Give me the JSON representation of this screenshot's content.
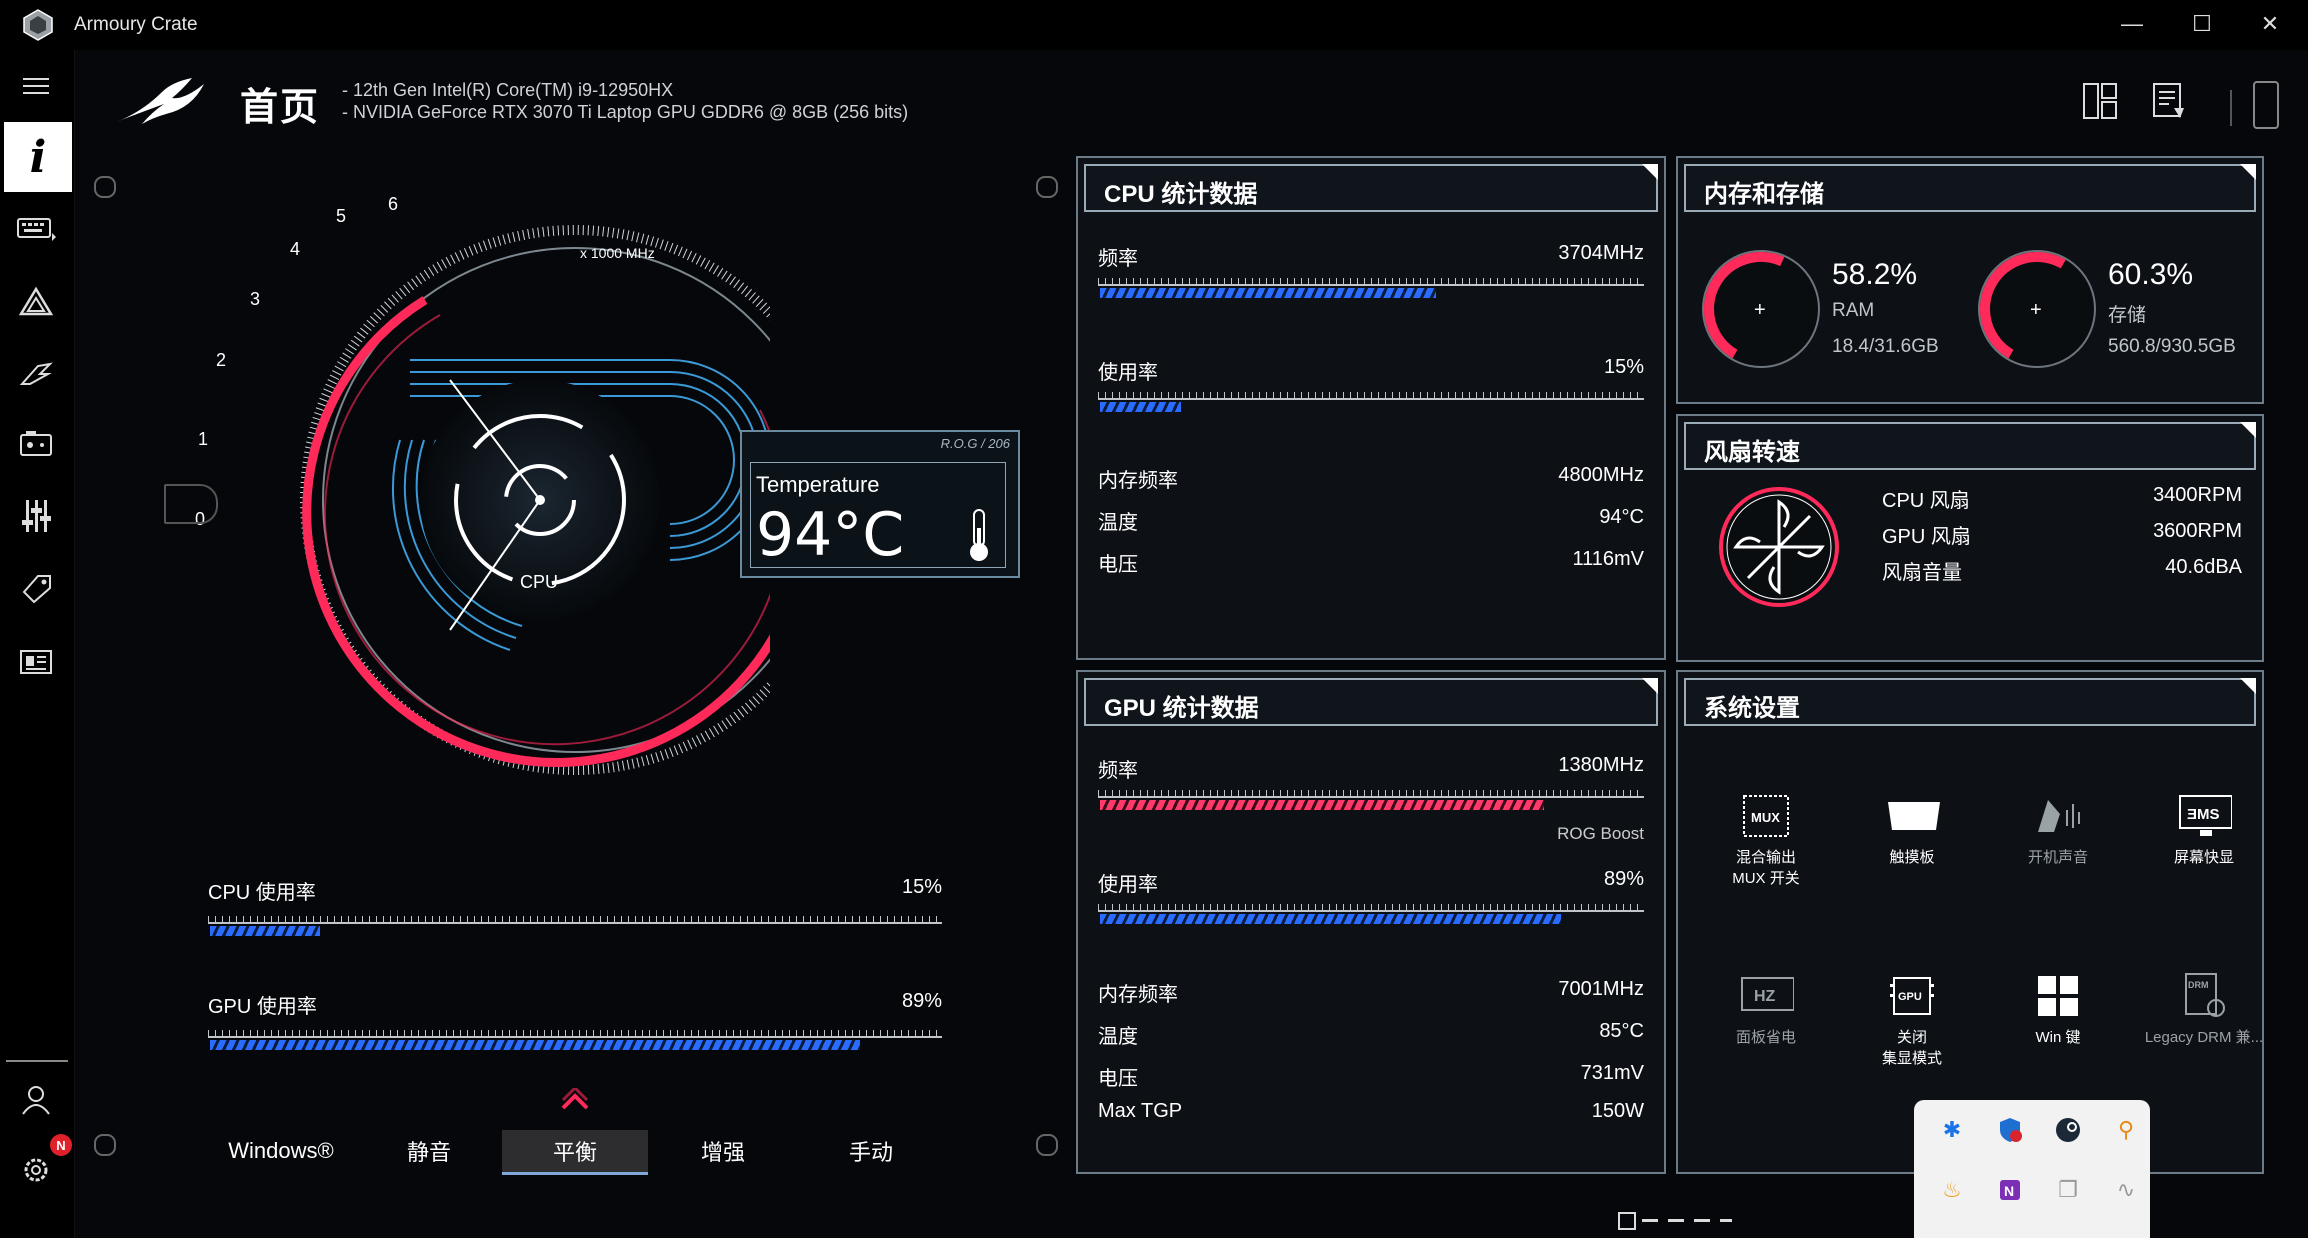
{
  "window": {
    "title": "Armoury Crate",
    "minimize": "—",
    "maximize": "☐",
    "close": "✕"
  },
  "header": {
    "page_title": "首页",
    "cpu_spec": "-   12th Gen Intel(R) Core(TM) i9-12950HX",
    "gpu_spec": "-   NVIDIA GeForce RTX 3070 Ti Laptop GPU GDDR6 @ 8GB (256 bits)"
  },
  "sidebar": {
    "items": [
      "menu-icon",
      "info-icon",
      "keyboard-icon",
      "aura-icon",
      "rog-icon",
      "game-library-icon",
      "scenario-icon",
      "deals-icon",
      "news-icon"
    ],
    "bottom": [
      "user-icon",
      "settings-icon"
    ],
    "settings_badge": "N"
  },
  "gauge": {
    "unit_label": "x 1000 MHz",
    "ticks": [
      "0",
      "1",
      "2",
      "3",
      "4",
      "5",
      "6"
    ],
    "center_label": "CPU",
    "accent": "#ff2a5a"
  },
  "temperature": {
    "tag": "R.O.G / 206",
    "label": "Temperature",
    "value": "94°C"
  },
  "usage": {
    "cpu_label": "CPU 使用率",
    "cpu_value": "15%",
    "cpu_fraction": 0.15,
    "gpu_label": "GPU 使用率",
    "gpu_value": "89%",
    "gpu_fraction": 0.89
  },
  "modes": {
    "items": [
      "Windows®",
      "静音",
      "平衡",
      "增强",
      "手动"
    ],
    "selected": "平衡"
  },
  "cpu_panel": {
    "title": "CPU 统计数据",
    "freq_label": "频率",
    "freq_value": "3704MHz",
    "freq_fraction": 0.62,
    "usage_label": "使用率",
    "usage_value": "15%",
    "usage_fraction": 0.15,
    "mem_freq_label": "内存频率",
    "mem_freq_value": "4800MHz",
    "temp_label": "温度",
    "temp_value": "94°C",
    "volt_label": "电压",
    "volt_value": "1116mV"
  },
  "gpu_panel": {
    "title": "GPU 统计数据",
    "freq_label": "频率",
    "freq_value": "1380MHz",
    "freq_fraction": 0.82,
    "boost_label": "ROG Boost",
    "usage_label": "使用率",
    "usage_value": "89%",
    "usage_fraction": 0.85,
    "mem_freq_label": "内存频率",
    "mem_freq_value": "7001MHz",
    "temp_label": "温度",
    "temp_value": "85°C",
    "volt_label": "电压",
    "volt_value": "731mV",
    "tgp_label": "Max TGP",
    "tgp_value": "150W"
  },
  "memory_panel": {
    "title": "内存和存储",
    "ram_pct": "58.2%",
    "ram_label": "RAM",
    "ram_detail": "18.4/31.6GB",
    "ram_fraction": 0.582,
    "disk_pct": "60.3%",
    "disk_label": "存储",
    "disk_detail": "560.8/930.5GB",
    "disk_fraction": 0.603
  },
  "fan_panel": {
    "title": "风扇转速",
    "cpu_fan_label": "CPU 风扇",
    "cpu_fan_value": "3400RPM",
    "gpu_fan_label": "GPU 风扇",
    "gpu_fan_value": "3600RPM",
    "noise_label": "风扇音量",
    "noise_value": "40.6dBA"
  },
  "system_panel": {
    "title": "系统设置",
    "items": [
      {
        "line1": "混合输出",
        "line2": "MUX 开关"
      },
      {
        "line1": "",
        "line2": "触摸板"
      },
      {
        "line1": "",
        "line2": "开机声音"
      },
      {
        "line1": "",
        "line2": "屏幕快显"
      },
      {
        "line1": "",
        "line2": "面板省电"
      },
      {
        "line1": "关闭",
        "line2": "集显模式"
      },
      {
        "line1": "",
        "line2": "Win 键"
      },
      {
        "line1": "",
        "line2": "Legacy DRM 兼..."
      }
    ],
    "icon_text": {
      "mux": "MUX",
      "hz": "HZ",
      "gpu": "GPU",
      "ams": "ƎMS",
      "drm": "DRM"
    }
  },
  "tray": {
    "icons": [
      "bluetooth-icon",
      "security-icon",
      "steam-icon",
      "search-tool-icon",
      "flame-icon",
      "onenote-icon",
      "window-icon",
      "audio-icon"
    ]
  }
}
